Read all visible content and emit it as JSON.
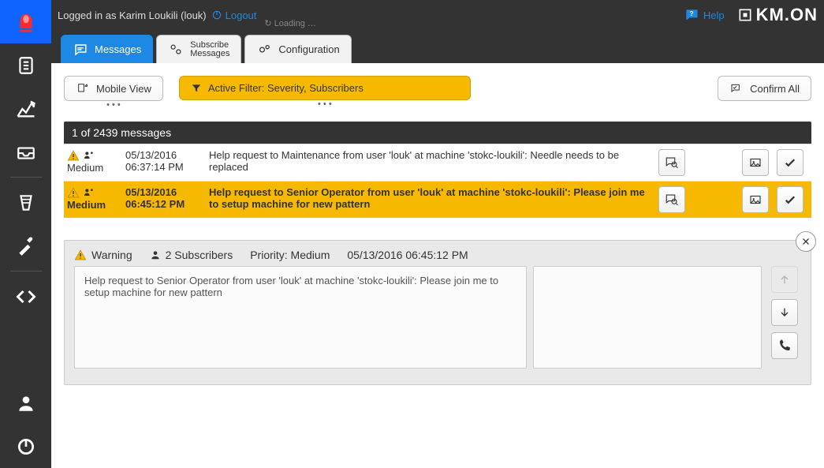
{
  "topbar": {
    "logged_in_prefix": "Logged in as",
    "user_name": "Karim Loukili",
    "user_id": "(louk)",
    "logout_label": "Logout",
    "loading_label": "Loading …",
    "help_label": "Help",
    "logo_text": "KM.ON"
  },
  "tabs": {
    "messages": "Messages",
    "subscribe_line1": "Subscribe",
    "subscribe_line2": "Messages",
    "configuration": "Configuration"
  },
  "toolbar": {
    "mobile_view": "Mobile View",
    "active_filter": "Active Filter: Severity, Subscribers",
    "confirm_all": "Confirm All"
  },
  "counter": {
    "text": "1 of 2439 messages"
  },
  "messages": [
    {
      "severity": "Medium",
      "date": "05/13/2016",
      "time": "06:37:14 PM",
      "text": "Help request to Maintenance from user 'louk' at machine 'stokc-loukili': Needle needs to be replaced",
      "selected": false
    },
    {
      "severity": "Medium",
      "date": "05/13/2016",
      "time": "06:45:12 PM",
      "text": "Help request to Senior Operator from user 'louk' at machine 'stokc-loukili': Please join me to setup machine for new pattern",
      "selected": true
    }
  ],
  "detail": {
    "warning_label": "Warning",
    "subscribers_label": "2 Subscribers",
    "priority_label": "Priority: Medium",
    "timestamp": "05/13/2016 06:45:12 PM",
    "body": "Help request to Senior Operator from user 'louk' at machine 'stokc-loukili': Please join me to setup machine for new pattern"
  },
  "colors": {
    "accent_blue": "#1e88e5",
    "warning_yellow": "#f7b900",
    "sidebar_dark": "#333333"
  }
}
